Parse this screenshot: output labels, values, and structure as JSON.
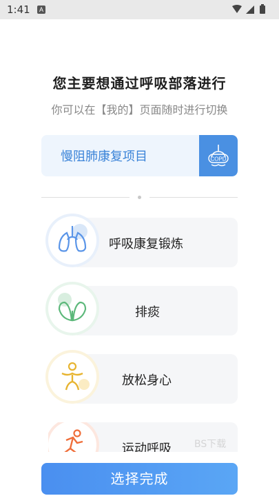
{
  "status_bar": {
    "time": "1:41",
    "notification_glyph": "A"
  },
  "heading": "您主要想通过呼吸部落进行",
  "subheading": "你可以在【我的】页面随时进行切换",
  "project": {
    "label": "慢阻肺康复项目",
    "icon_text": "COPD"
  },
  "options": [
    {
      "label": "呼吸康复锻炼",
      "icon": "lungs-icon",
      "color": "#5a95e8"
    },
    {
      "label": "排痰",
      "icon": "leaf-icon",
      "color": "#5cb87a"
    },
    {
      "label": "放松身心",
      "icon": "relax-figure-icon",
      "color": "#e7b430"
    },
    {
      "label": "运动呼吸",
      "icon": "runner-icon",
      "color": "#ef6e3a"
    }
  ],
  "watermark": "BS下载",
  "complete_button": "选择完成"
}
